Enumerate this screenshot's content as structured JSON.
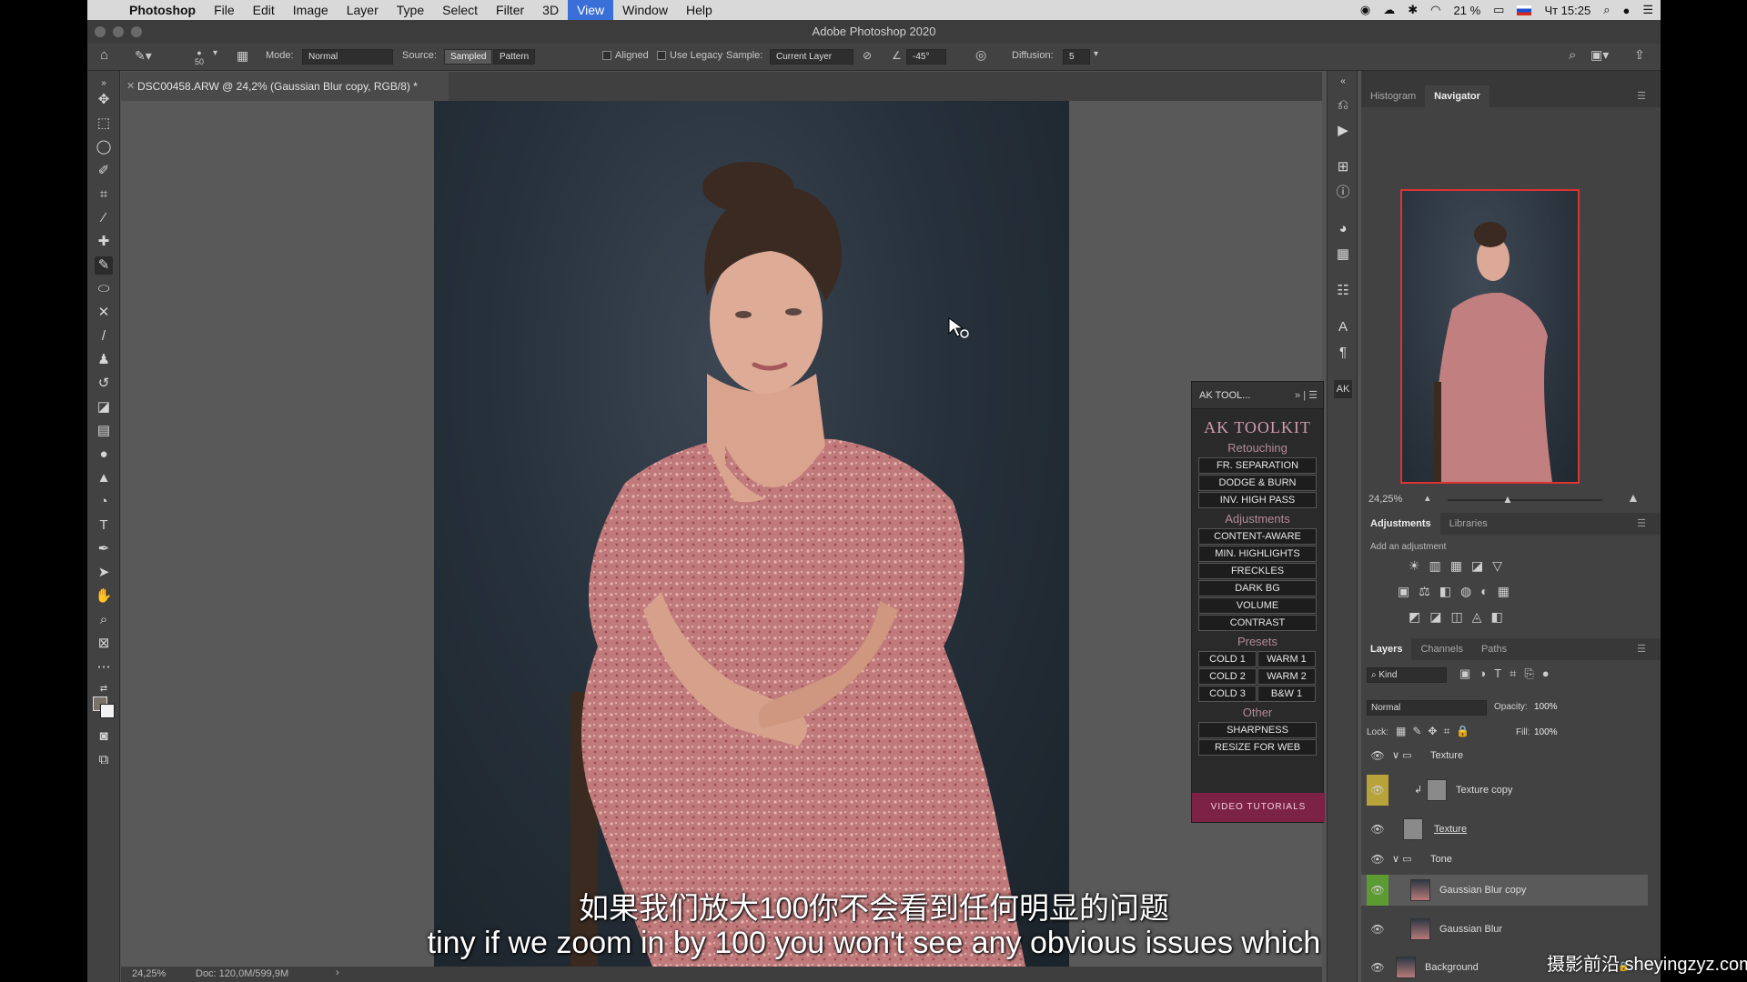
{
  "menubar": {
    "app": "Photoshop",
    "items": [
      "File",
      "Edit",
      "Image",
      "Layer",
      "Type",
      "Select",
      "Filter",
      "3D",
      "View",
      "Window",
      "Help"
    ],
    "active": "View",
    "battery": "21 %",
    "clock": "Чт 15:25"
  },
  "window": {
    "title": "Adobe Photoshop 2020"
  },
  "options": {
    "brush_size": "50",
    "mode_label": "Mode:",
    "mode_value": "Normal",
    "source_label": "Source:",
    "source_sampled": "Sampled",
    "source_pattern": "Pattern",
    "aligned": "Aligned",
    "use_legacy": "Use Legacy",
    "sample_label": "Sample:",
    "sample_value": "Current Layer",
    "angle": "-45°",
    "diffusion_label": "Diffusion:",
    "diffusion_value": "5"
  },
  "document": {
    "tab": "DSC00458.ARW @ 24,2% (Gaussian Blur copy, RGB/8) *",
    "zoom": "24,25%",
    "doc_size": "Doc: 120,0M/599,9M"
  },
  "subtitles": {
    "zh": "如果我们放大100你不会看到任何明显的问题",
    "en": "tiny if we zoom in by 100 you won't see any obvious issues which"
  },
  "watermark": "摄影前沿 sheyingzyz.com",
  "ak_panel": {
    "tab": "AK TOOL...",
    "logo": "AK TOOLKIT",
    "sections": {
      "retouching": "Retouching",
      "adjustments": "Adjustments",
      "presets": "Presets",
      "other": "Other"
    },
    "retouching_buttons": [
      "FR. SEPARATION",
      "DODGE & BURN",
      "INV. HIGH PASS"
    ],
    "adjustment_buttons": [
      "CONTENT-AWARE",
      "MIN. HIGHLIGHTS",
      "FRECKLES",
      "DARK BG",
      "VOLUME",
      "CONTRAST"
    ],
    "preset_buttons": [
      [
        "COLD 1",
        "WARM 1"
      ],
      [
        "COLD 2",
        "WARM 2"
      ],
      [
        "COLD 3",
        "B&W 1"
      ]
    ],
    "other_buttons": [
      "SHARPNESS",
      "RESIZE FOR WEB"
    ],
    "video": "VIDEO TUTORIALS"
  },
  "navigator": {
    "tabs": [
      "Histogram",
      "Navigator"
    ],
    "active": "Navigator",
    "zoom": "24,25%"
  },
  "adjustments": {
    "tabs": [
      "Adjustments",
      "Libraries"
    ],
    "active": "Adjustments",
    "hint": "Add an adjustment"
  },
  "layers": {
    "tabs": [
      "Layers",
      "Channels",
      "Paths"
    ],
    "active": "Layers",
    "filter": "Kind",
    "blend": "Normal",
    "opacity_label": "Opacity:",
    "opacity": "100%",
    "lock_label": "Lock:",
    "fill_label": "Fill:",
    "fill": "100%",
    "rows": [
      {
        "name": "Texture",
        "type": "group"
      },
      {
        "name": "Texture copy",
        "type": "layer"
      },
      {
        "name": "Texture",
        "type": "layer"
      },
      {
        "name": "Tone",
        "type": "group"
      },
      {
        "name": "Gaussian Blur copy",
        "type": "layer",
        "selected": true
      },
      {
        "name": "Gaussian Blur",
        "type": "layer"
      },
      {
        "name": "Background",
        "type": "layer",
        "locked": true
      }
    ]
  },
  "colors": {
    "ps_bg": "#535353",
    "panel": "#424242",
    "ak_accent": "#7c2245",
    "nav_frame": "#d33333",
    "eye_highlight_yellow": "#b8a23a",
    "eye_highlight_green": "#5c9a32"
  }
}
